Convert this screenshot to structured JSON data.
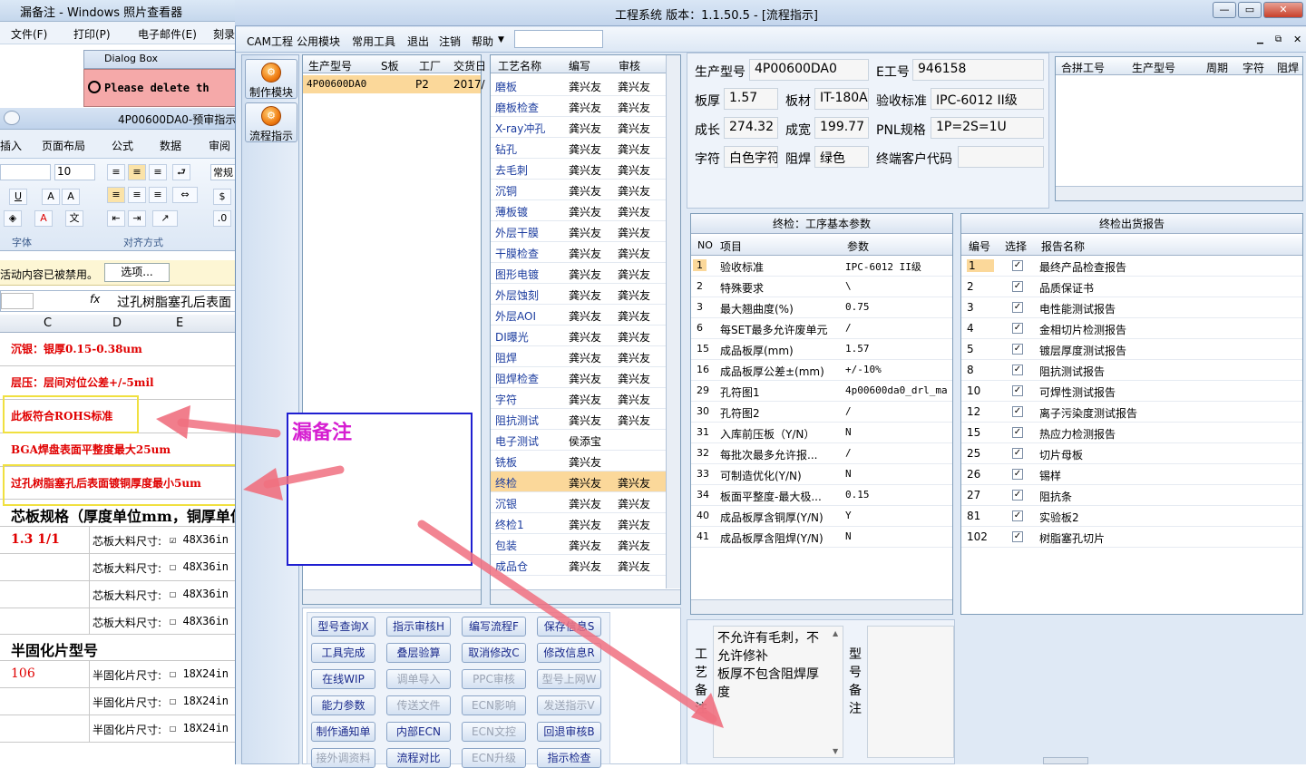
{
  "bg_viewer": {
    "title": "漏备注 - Windows 照片查看器",
    "menu": [
      "文件(F)",
      "打印(P)",
      "电子邮件(E)",
      "刻录"
    ]
  },
  "dialog": {
    "title": "Dialog Box",
    "message": "Please delete th"
  },
  "excel": {
    "title": "4P00600DA0-预审指示",
    "tabs": [
      "插入",
      "页面布局",
      "公式",
      "数据",
      "审阅"
    ],
    "font_size": "10",
    "groups": [
      "字体",
      "对齐方式"
    ],
    "number_format": "常规",
    "security_msg": "活动内容已被禁用。",
    "options_btn": "选项...",
    "fx": "fx",
    "formula_text": "过孔树脂塞孔后表面",
    "cols": [
      "C",
      "D",
      "E"
    ],
    "notes": [
      "沉银：银厚0.15-0.38um",
      "层压：层间对位公差+/-5mil",
      "此板符合ROHS标准",
      "BGA焊盘表面平整度最大25um",
      "过孔树脂塞孔后表面镀铜厚度最小5um"
    ],
    "core_title": "芯板规格（厚度单位mm，铜厚单位",
    "core_value": "1.3 1/1",
    "core_label": "芯板大料尺寸:",
    "core_sizes": [
      "48X36in",
      "48X36in",
      "48X36in",
      "48X36in"
    ],
    "prepreg_title": "半固化片型号",
    "prepreg_value": "106",
    "prepreg_label": "半固化片尺寸:",
    "prepreg_sizes": [
      "18X24in",
      "18X24in",
      "18X24in"
    ]
  },
  "main": {
    "title": "工程系统    版本：1.1.50.5 - [流程指示]",
    "menu": [
      "CAM工程",
      "公用模块",
      "常用工具",
      "退出",
      "注销",
      "帮助"
    ],
    "nav": [
      {
        "label": "制作模块",
        "icon": "gear-icon"
      },
      {
        "label": "流程指示",
        "icon": "gear-icon"
      }
    ]
  },
  "order_grid": {
    "headers": [
      "生产型号",
      "S板",
      "工厂",
      "交货日"
    ],
    "rows": [
      [
        "4P00600DA0",
        "",
        "P2",
        "2017/"
      ]
    ]
  },
  "process_grid": {
    "headers": [
      "工艺名称",
      "编写",
      "审核"
    ],
    "rows": [
      [
        "磨板",
        "龚兴友",
        "龚兴友"
      ],
      [
        "磨板检查",
        "龚兴友",
        "龚兴友"
      ],
      [
        "X-ray冲孔",
        "龚兴友",
        "龚兴友"
      ],
      [
        "钻孔",
        "龚兴友",
        "龚兴友"
      ],
      [
        "去毛刺",
        "龚兴友",
        "龚兴友"
      ],
      [
        "沉铜",
        "龚兴友",
        "龚兴友"
      ],
      [
        "薄板镀",
        "龚兴友",
        "龚兴友"
      ],
      [
        "外层干膜",
        "龚兴友",
        "龚兴友"
      ],
      [
        "干膜检查",
        "龚兴友",
        "龚兴友"
      ],
      [
        "图形电镀",
        "龚兴友",
        "龚兴友"
      ],
      [
        "外层蚀刻",
        "龚兴友",
        "龚兴友"
      ],
      [
        "外层AOI",
        "龚兴友",
        "龚兴友"
      ],
      [
        "DI曝光",
        "龚兴友",
        "龚兴友"
      ],
      [
        "阻焊",
        "龚兴友",
        "龚兴友"
      ],
      [
        "阻焊检查",
        "龚兴友",
        "龚兴友"
      ],
      [
        "字符",
        "龚兴友",
        "龚兴友"
      ],
      [
        "阻抗测试",
        "龚兴友",
        "龚兴友"
      ],
      [
        "电子测试",
        "侯添宝",
        ""
      ],
      [
        "铣板",
        "龚兴友",
        ""
      ],
      [
        "终检",
        "龚兴友",
        "龚兴友"
      ],
      [
        "沉银",
        "龚兴友",
        "龚兴友"
      ],
      [
        "终检1",
        "龚兴友",
        "龚兴友"
      ],
      [
        "包装",
        "龚兴友",
        "龚兴友"
      ],
      [
        "成品仓",
        "龚兴友",
        "龚兴友"
      ]
    ],
    "selected_index": 19
  },
  "actions": [
    [
      {
        "label": "型号查询X",
        "enabled": true
      },
      {
        "label": "指示审核H",
        "enabled": true
      },
      {
        "label": "编写流程F",
        "enabled": true
      },
      {
        "label": "保存信息S",
        "enabled": true
      }
    ],
    [
      {
        "label": "工具完成",
        "enabled": true
      },
      {
        "label": "叠层验算",
        "enabled": true
      },
      {
        "label": "取消修改C",
        "enabled": true
      },
      {
        "label": "修改信息R",
        "enabled": true
      }
    ],
    [
      {
        "label": "在线WIP",
        "enabled": true
      },
      {
        "label": "调单导入",
        "enabled": false
      },
      {
        "label": "PPC审核",
        "enabled": false
      },
      {
        "label": "型号上网W",
        "enabled": false
      }
    ],
    [
      {
        "label": "能力参数",
        "enabled": true
      },
      {
        "label": "传送文件",
        "enabled": false
      },
      {
        "label": "ECN影响",
        "enabled": false
      },
      {
        "label": "发送指示V",
        "enabled": false
      }
    ],
    [
      {
        "label": "制作通知单",
        "enabled": true
      },
      {
        "label": "内部ECN",
        "enabled": true
      },
      {
        "label": "ECN文控",
        "enabled": false
      },
      {
        "label": "回退审核B",
        "enabled": true
      }
    ],
    [
      {
        "label": "接外调资料",
        "enabled": false
      },
      {
        "label": "流程对比",
        "enabled": true
      },
      {
        "label": "ECN升级",
        "enabled": false
      },
      {
        "label": "指示检查",
        "enabled": true
      }
    ]
  ],
  "info": {
    "model_label": "生产型号",
    "model": "4P00600DA0",
    "e_label": "E工号",
    "e_no": "946158",
    "thk_label": "板厚",
    "thk": "1.57",
    "mat_label": "板材",
    "mat": "IT-180A",
    "std_label": "验收标准",
    "std": "IPC-6012 II级",
    "len_label": "成长",
    "len": "274.32",
    "wid_label": "成宽",
    "wid": "199.77",
    "pnl_label": "PNL规格",
    "pnl": "1P=2S=1U",
    "char_label": "字符",
    "char": "白色字符",
    "mask_label": "阻焊",
    "mask": "绿色",
    "cust_label": "终端客户代码",
    "cust": ""
  },
  "merge_grid": {
    "headers": [
      "合拼工号",
      "生产型号",
      "周期",
      "字符",
      "阻焊"
    ]
  },
  "params": {
    "title": "终检：工序基本参数",
    "headers": [
      "NO",
      "项目",
      "参数"
    ],
    "rows": [
      [
        "1",
        "验收标准",
        "IPC-6012 II级"
      ],
      [
        "2",
        "特殊要求",
        "\\"
      ],
      [
        "3",
        "最大翘曲度(%)",
        "0.75"
      ],
      [
        "6",
        "每SET最多允许废单元",
        "/"
      ],
      [
        "15",
        "成品板厚(mm)",
        "1.57"
      ],
      [
        "16",
        "成品板厚公差±(mm)",
        "+/-10%"
      ],
      [
        "29",
        "孔符图1",
        "4p00600da0_drl_ma"
      ],
      [
        "30",
        "孔符图2",
        "/"
      ],
      [
        "31",
        "入库前压板（Y/N）",
        "N"
      ],
      [
        "32",
        "每批次最多允许报...",
        "/"
      ],
      [
        "33",
        "可制造优化(Y/N)",
        "N"
      ],
      [
        "34",
        "板面平整度-最大极...",
        "0.15"
      ],
      [
        "40",
        "成品板厚含铜厚(Y/N)",
        "Y"
      ],
      [
        "41",
        "成品板厚含阻焊(Y/N)",
        "N"
      ]
    ]
  },
  "reports": {
    "title": "终检出货报告",
    "headers": [
      "编号",
      "选择",
      "报告名称"
    ],
    "rows": [
      [
        "1",
        "最终产品检查报告"
      ],
      [
        "2",
        "品质保证书"
      ],
      [
        "3",
        "电性能测试报告"
      ],
      [
        "4",
        "金相切片检测报告"
      ],
      [
        "5",
        "镀层厚度测试报告"
      ],
      [
        "8",
        "阻抗测试报告"
      ],
      [
        "10",
        "可焊性测试报告"
      ],
      [
        "12",
        "离子污染度测试报告"
      ],
      [
        "15",
        "热应力检测报告"
      ],
      [
        "25",
        "切片母板"
      ],
      [
        "26",
        "锡样"
      ],
      [
        "27",
        "阻抗条"
      ],
      [
        "81",
        "实验板2"
      ],
      [
        "102",
        "树脂塞孔切片"
      ]
    ]
  },
  "remarks": {
    "process_label": "工艺备注",
    "process_text": "不允许有毛刺，不允许修补\n板厚不包含阻焊厚度",
    "model_label": "型号备注"
  },
  "annotation": {
    "text": "漏备注"
  },
  "colors": {
    "highlight_row": "#fbd89a",
    "accent": "#1f1fd1",
    "annotation_text": "#d61fd1",
    "arrow": "#f07080",
    "note_red": "#e00000"
  }
}
